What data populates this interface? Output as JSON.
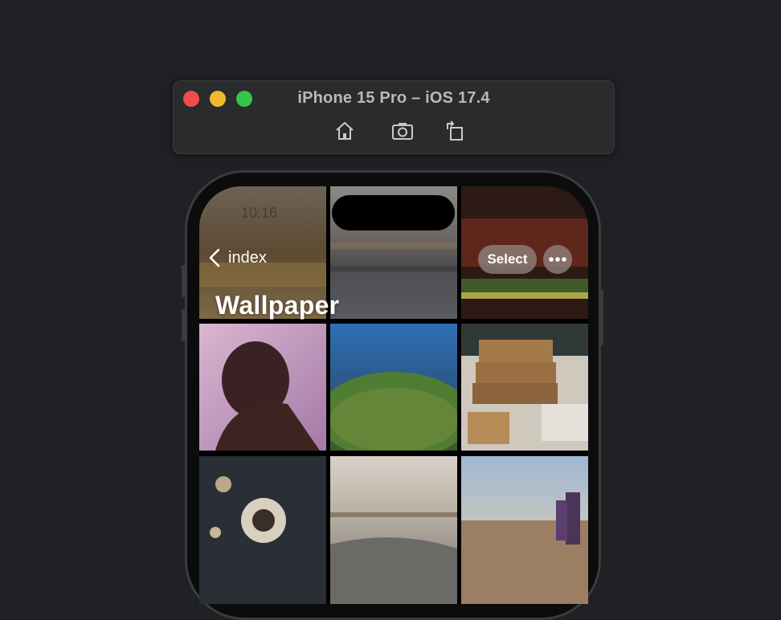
{
  "simulator": {
    "title": "iPhone 15 Pro – iOS 17.4",
    "toolbar": {
      "home_icon": "home-icon",
      "screenshot_icon": "camera-icon",
      "rotate_icon": "rotate-icon"
    }
  },
  "status_bar": {
    "time": "10:16"
  },
  "nav": {
    "back_label": "index",
    "select_label": "Select",
    "more_icon": "ellipsis-icon",
    "large_title": "Wallpaper"
  },
  "colors": {
    "background": "#1f2124",
    "window_chrome": "#2a2b2d",
    "close": "#ee4d4b",
    "minimize": "#f2b92e",
    "maximize": "#34c748"
  }
}
